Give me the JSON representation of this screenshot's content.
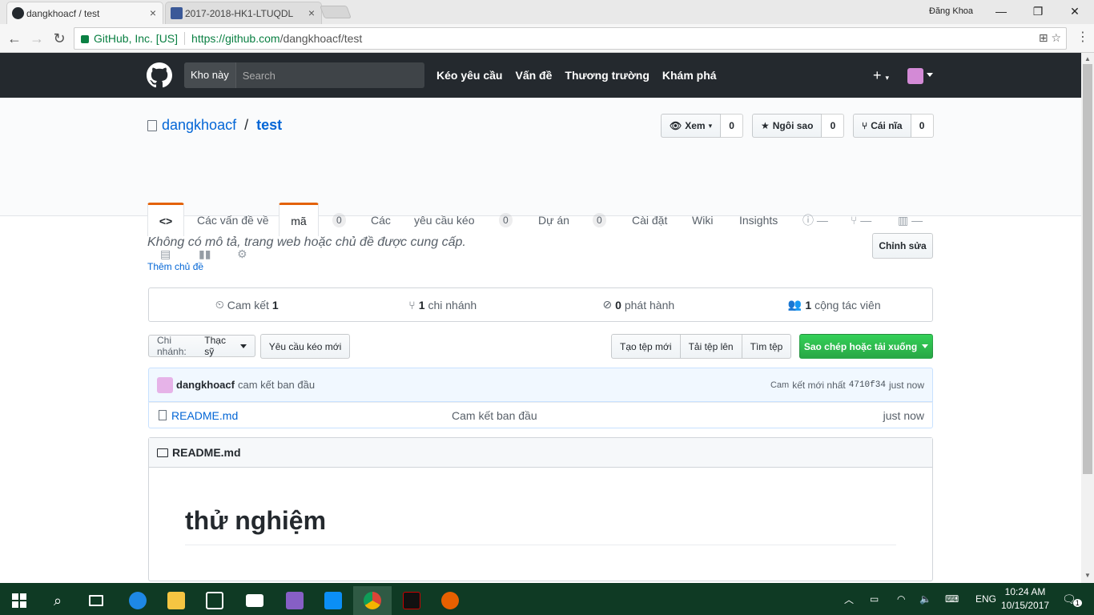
{
  "browser": {
    "tabs": [
      {
        "title": "dangkhoacf / test",
        "active": true
      },
      {
        "title": "2017-2018-HK1-LTUQDL",
        "active": false
      }
    ],
    "window_user": "Đăng Khoa",
    "secure_label": "GitHub, Inc. [US]",
    "url_host": "https://github.com",
    "url_path": "/dangkhoacf/test"
  },
  "header": {
    "scope_label": "Kho này",
    "search_placeholder": "Search",
    "nav": [
      "Kéo yêu cầu",
      "Vấn đề",
      "Thương trường",
      "Khám phá"
    ],
    "plus": "+"
  },
  "repo": {
    "owner": "dangkhoacf",
    "separator": "/",
    "name": "test",
    "watch_label": "Xem",
    "watch_count": "0",
    "star_label": "Ngôi sao",
    "star_count": "0",
    "fork_label": "Cái nĩa",
    "fork_count": "0"
  },
  "reponav": {
    "code_icon": "<>",
    "issues_text": "Các vấn đề về",
    "code_label": "mã",
    "count_a": "0",
    "cac": "Các",
    "pr_text": "yêu cầu kéo",
    "count_b": "0",
    "projects": "Dự án",
    "count_c": "0",
    "settings": "Cài đặt",
    "wiki": "Wiki",
    "insights": "Insights"
  },
  "about": {
    "description": "Không có mô tả, trang web hoặc chủ đề được cung cấp.",
    "add_topics": "Thêm chủ đề",
    "edit_button": "Chỉnh sửa"
  },
  "summary": {
    "commits_label": "Cam kết",
    "commits_count": "1",
    "branches_count": "1",
    "branches_label": "chi nhánh",
    "releases_count": "0",
    "releases_label": "phát hành",
    "contributors_count": "1",
    "contributors_label": "cộng tác viên"
  },
  "file_nav": {
    "branch_prefix": "Chi nhánh:",
    "branch_name": "Thạc sỹ",
    "new_pr": "Yêu cầu kéo mới",
    "create_file": "Tạo tệp mới",
    "upload_files": "Tải tệp lên",
    "find_file": "Tìm tệp",
    "clone": "Sao chép hoặc tải xuống"
  },
  "commit": {
    "author": "dangkhoacf",
    "message": "cam kết ban đầu",
    "latest_prefix": "Cam",
    "latest_label": "kết mới nhất",
    "sha": "4710f34",
    "time": "just now"
  },
  "files": [
    {
      "name": "README.md",
      "message": "Cam kết ban đầu",
      "age": "just now"
    }
  ],
  "readme": {
    "filename": "README.md",
    "heading": "thử nghiệm"
  },
  "taskbar": {
    "lang": "ENG",
    "time": "10:24 AM",
    "date": "10/15/2017",
    "notifications": "1"
  },
  "colors": {
    "gh_header": "#24292e",
    "accent_orange": "#e36209",
    "link_blue": "#0366d6",
    "green_button": "#28a745",
    "taskbar": "#0f3a24"
  }
}
